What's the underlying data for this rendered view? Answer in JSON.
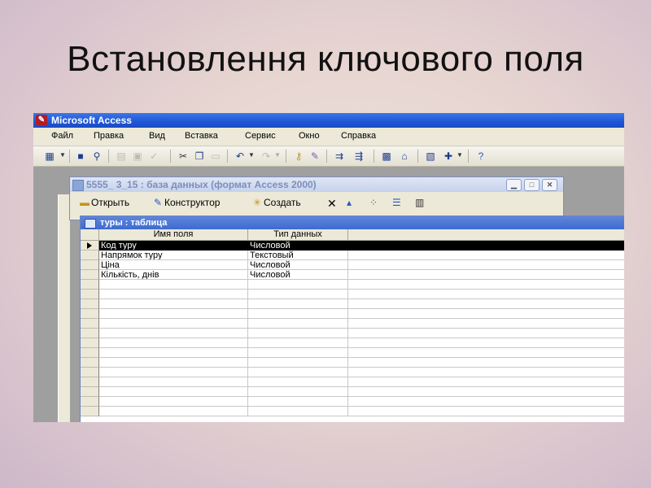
{
  "slide": {
    "title": "Встановлення ключового поля"
  },
  "app": {
    "title": "Microsoft Access",
    "menu": [
      "Файл",
      "Правка",
      "Вид",
      "Вставка",
      "Сервис",
      "Окно",
      "Справка"
    ],
    "toolbar_icons": [
      "table-view-icon",
      "save-icon",
      "search-icon",
      "print-icon",
      "print-preview-icon",
      "spelling-icon",
      "cut-icon",
      "copy-icon",
      "paste-icon",
      "undo-icon",
      "redo-icon",
      "primary-key-icon",
      "build-icon",
      "insert-rows-icon",
      "delete-rows-icon",
      "properties-icon",
      "indexes-icon",
      "database-window-icon",
      "new-object-icon",
      "help-icon"
    ]
  },
  "db_window": {
    "title": "5555_ 3_15 : база данных (формат Access 2000)",
    "toolbar": {
      "open_label": "Открыть",
      "design_label": "Конструктор",
      "create_label": "Создать"
    }
  },
  "design_window": {
    "title": "туры : таблица",
    "columns": [
      "Имя поля",
      "Тип данных"
    ],
    "rows": [
      {
        "name": "Код туру",
        "type": "Числовой",
        "selected": true
      },
      {
        "name": "Напрямок туру",
        "type": "Текстовый"
      },
      {
        "name": "Ціна",
        "type": "Числовой"
      },
      {
        "name": "Кількість, днів",
        "type": "Числовой"
      }
    ]
  },
  "colors": {
    "title_bar": "#1f56d6",
    "selected_row": "#000000",
    "workspace": "#9f9f9f"
  }
}
